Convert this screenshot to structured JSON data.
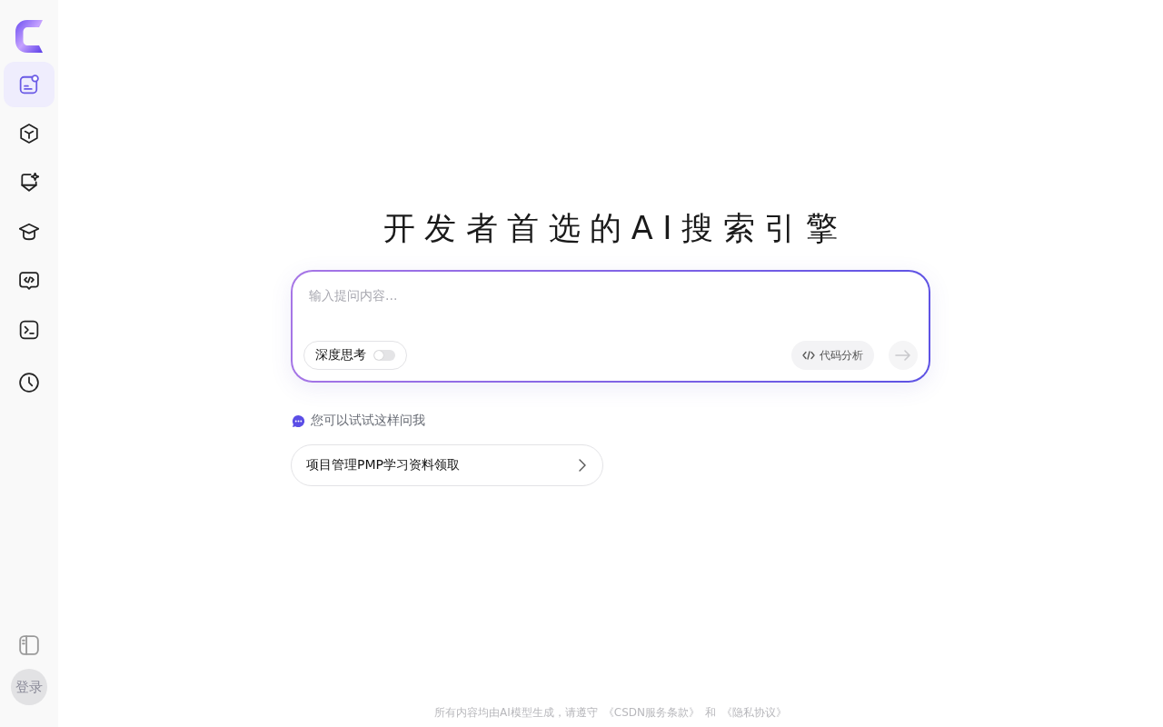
{
  "sidebar": {
    "items": [
      {
        "selected": true
      },
      {
        "selected": false
      },
      {
        "selected": false
      },
      {
        "selected": false
      },
      {
        "selected": false
      },
      {
        "selected": false
      },
      {
        "selected": false
      }
    ],
    "login_button": {
      "label": "登录"
    }
  },
  "heading": "开发者首选的AI搜索引擎",
  "composer": {
    "placeholder": "输入提问内容...",
    "deep_think": {
      "label": "深度思考",
      "on": false
    },
    "code_analysis": {
      "label": "代码分析"
    },
    "send_button": {
      "disabled": true
    }
  },
  "suggestions": {
    "title": "您可以试试这样问我",
    "items": [
      "项目管理PMP学习资料领取"
    ]
  },
  "footer": {
    "text": "所有内容均由AI模型生成，请遵守",
    "links": [
      "《CSDN服务条款》",
      "《隐私协议》"
    ],
    "conjunction": "和"
  }
}
